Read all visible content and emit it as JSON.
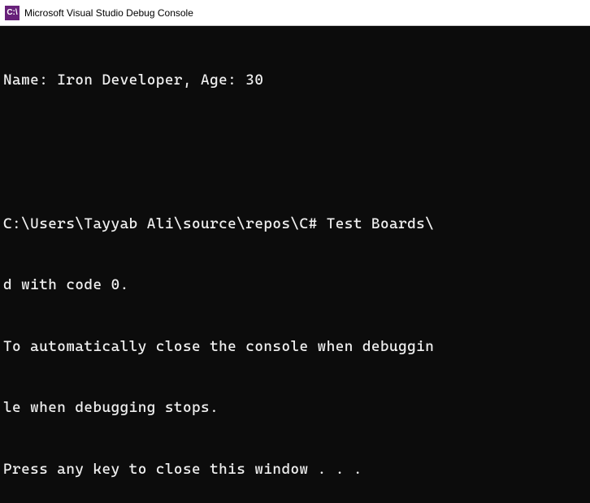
{
  "titlebar": {
    "icon_text": "C:\\",
    "title": "Microsoft Visual Studio Debug Console"
  },
  "console": {
    "lines": [
      "Name: Iron Developer, Age: 30",
      "",
      "",
      "C:\\Users\\Tayyab Ali\\source\\repos\\C# Test Boards\\",
      "d with code 0.",
      "To automatically close the console when debuggin",
      "le when debugging stops.",
      "Press any key to close this window . . ."
    ]
  }
}
